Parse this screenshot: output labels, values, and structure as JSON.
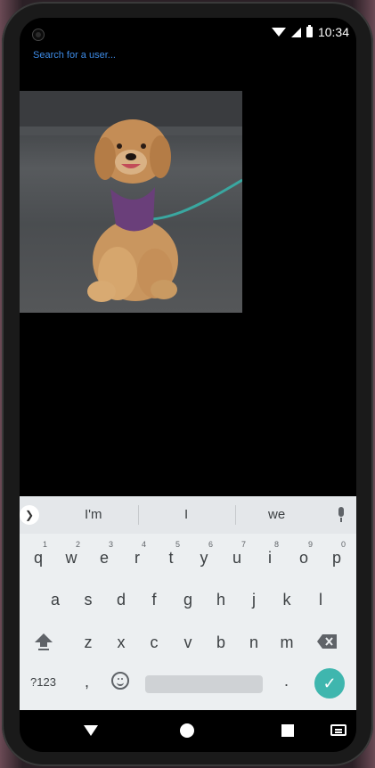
{
  "status_bar": {
    "time": "10:34"
  },
  "search": {
    "link_text": "Search for a user..."
  },
  "keyboard": {
    "suggestions": [
      "I'm",
      "I",
      "we"
    ],
    "row1": [
      {
        "key": "q",
        "hint": "1"
      },
      {
        "key": "w",
        "hint": "2"
      },
      {
        "key": "e",
        "hint": "3"
      },
      {
        "key": "r",
        "hint": "4"
      },
      {
        "key": "t",
        "hint": "5"
      },
      {
        "key": "y",
        "hint": "6"
      },
      {
        "key": "u",
        "hint": "7"
      },
      {
        "key": "i",
        "hint": "8"
      },
      {
        "key": "o",
        "hint": "9"
      },
      {
        "key": "p",
        "hint": "0"
      }
    ],
    "row2": [
      "a",
      "s",
      "d",
      "f",
      "g",
      "h",
      "j",
      "k",
      "l"
    ],
    "row3": [
      "z",
      "x",
      "c",
      "v",
      "b",
      "n",
      "m"
    ],
    "symbols_label": "?123",
    "comma": ",",
    "period": "."
  }
}
